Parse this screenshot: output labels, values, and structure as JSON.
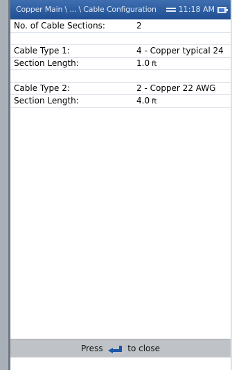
{
  "titlebar": {
    "path": "Copper Main \\ ... \\ Cable Configuration",
    "time": "11:18 AM"
  },
  "config": {
    "sections_label": "No. of Cable Sections:",
    "sections_value": "2",
    "cable1_type_label": "Cable Type 1:",
    "cable1_type_value": "4 - Copper typical 24",
    "cable1_length_label": "Section Length:",
    "cable1_length_value": "1.0",
    "cable1_length_unit": "ft",
    "cable2_type_label": "Cable Type 2:",
    "cable2_type_value": "2 - Copper 22 AWG",
    "cable2_length_label": "Section Length:",
    "cable2_length_value": "4.0",
    "cable2_length_unit": "ft"
  },
  "footer": {
    "press": "Press",
    "to_close": "to close"
  },
  "icons": {
    "network": "network-arrows-icon",
    "battery": "battery-icon",
    "enter": "enter-key-icon"
  },
  "colors": {
    "titlebar": "#2b5a9c",
    "footer": "#bfc3c7",
    "enter_icon": "#1b55a8"
  }
}
